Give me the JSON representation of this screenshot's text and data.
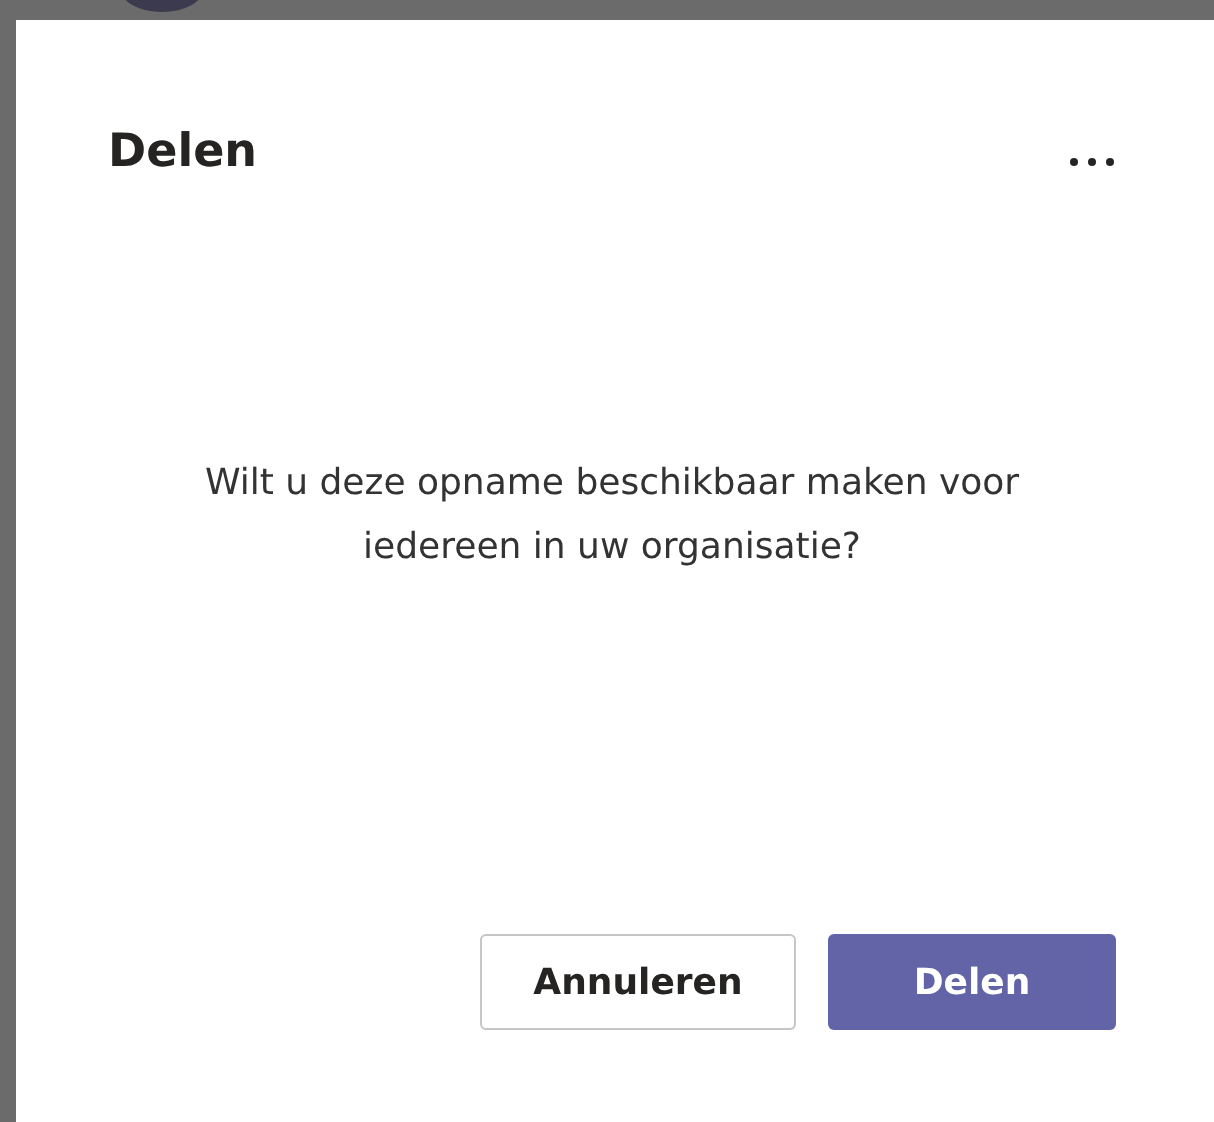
{
  "dialog": {
    "title": "Delen",
    "message": "Wilt u deze opname beschikbaar maken voor iedereen in uw organisatie?",
    "buttons": [
      {
        "label": "Annuleren",
        "kind": "secondary"
      },
      {
        "label": "Delen",
        "kind": "primary"
      }
    ]
  }
}
